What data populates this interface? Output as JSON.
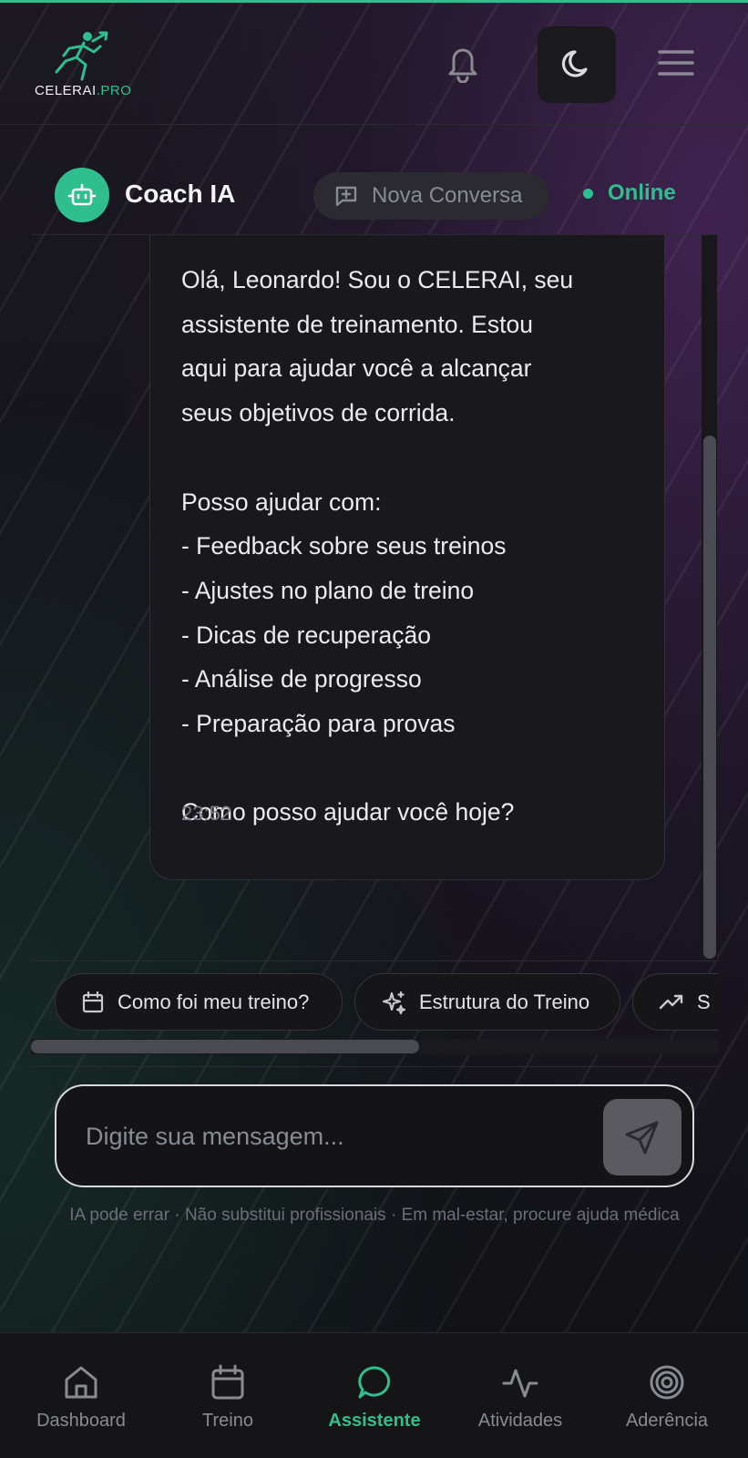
{
  "header": {
    "logo_text_main": "CELERAI",
    "logo_text_accent": ".PRO",
    "accent_color": "#2fbf8f"
  },
  "chat": {
    "title": "Coach IA",
    "new_conversation_label": "Nova Conversa",
    "status_label": "Online"
  },
  "message": {
    "text": "Olá, Leonardo! Sou o CELERAI, seu\nassistente de treinamento. Estou\naqui para ajudar você a alcançar\nseus objetivos de corrida.\n\nPosso ajudar com:\n- Feedback sobre seus treinos\n- Ajustes no plano de treino\n- Dicas de recuperação\n- Análise de progresso\n- Preparação para provas\n\nComo posso ajudar você hoje?",
    "time": "23:52"
  },
  "suggestions": [
    {
      "label": "Como foi meu treino?",
      "icon": "calendar-icon"
    },
    {
      "label": "Estrutura do Treino",
      "icon": "sparkles-icon"
    },
    {
      "label": "S",
      "icon": "trending-up-icon"
    }
  ],
  "composer": {
    "placeholder": "Digite sua mensagem...",
    "disclaimer": "IA pode errar · Não substitui profissionais · Em mal-estar, procure ajuda médica"
  },
  "nav": {
    "items": [
      {
        "label": "Dashboard",
        "icon": "home-icon",
        "active": false
      },
      {
        "label": "Treino",
        "icon": "calendar-icon",
        "active": false
      },
      {
        "label": "Assistente",
        "icon": "chat-bubble-icon",
        "active": true
      },
      {
        "label": "Atividades",
        "icon": "activity-icon",
        "active": false
      },
      {
        "label": "Aderência",
        "icon": "target-icon",
        "active": false
      }
    ]
  }
}
